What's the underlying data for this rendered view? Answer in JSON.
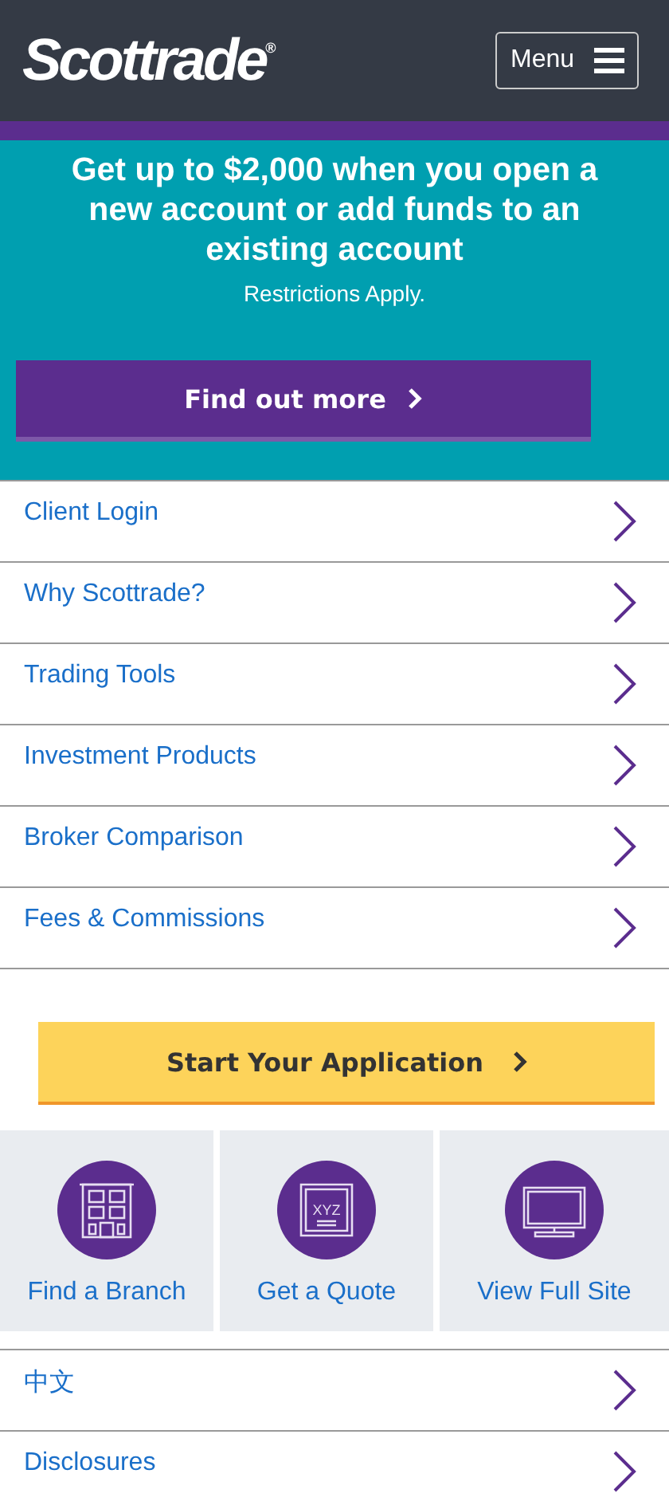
{
  "header": {
    "logo": "Scottrade",
    "logo_mark": "®",
    "menu_button": "Menu"
  },
  "promo": {
    "headline": "Get up to $2,000 when you open a new account or add funds to an existing account",
    "note": "Restrictions Apply.",
    "button": "Find out more"
  },
  "nav_items": [
    {
      "label": "Client Login"
    },
    {
      "label": "Why Scottrade?"
    },
    {
      "label": "Trading Tools"
    },
    {
      "label": "Investment Products"
    },
    {
      "label": "Broker Comparison"
    },
    {
      "label": "Fees & Commissions"
    }
  ],
  "application_button": "Start Your Application",
  "tiles": [
    {
      "kind": "building",
      "label": "Find a Branch"
    },
    {
      "kind": "quote",
      "label": "Get a Quote",
      "icon_text": "XYZ"
    },
    {
      "kind": "monitor",
      "label": "View Full Site"
    }
  ],
  "footer_items": [
    {
      "label": "中文"
    },
    {
      "label": "Disclosures"
    }
  ]
}
